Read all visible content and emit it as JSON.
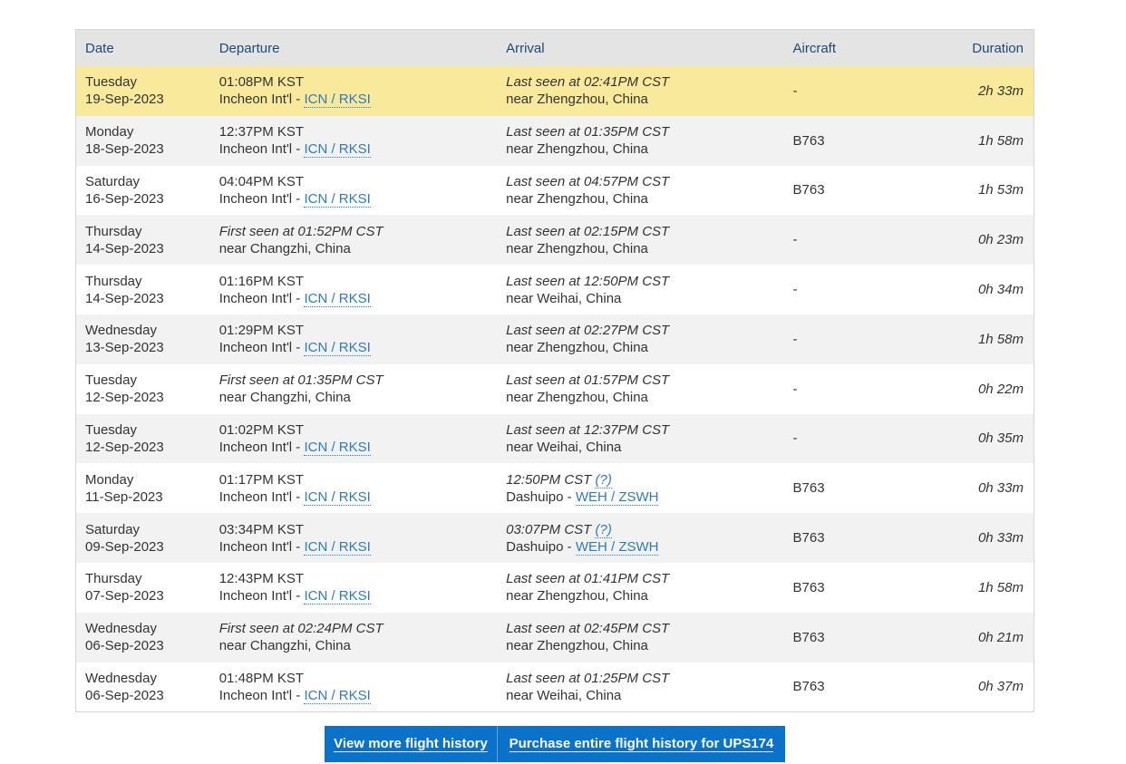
{
  "table": {
    "headers": {
      "date": "Date",
      "departure": "Departure",
      "arrival": "Arrival",
      "aircraft": "Aircraft",
      "duration": "Duration"
    },
    "rows": [
      {
        "day": "Tuesday",
        "date": "19-Sep-2023",
        "dep_time": "01:08PM KST",
        "dep_time_italic": false,
        "dep_place": "Incheon Int'l - ",
        "dep_code": "ICN / RKSI",
        "arr_time": "Last seen at 02:41PM CST",
        "arr_help": "",
        "arr_place": "near Zhengzhou, China",
        "arr_code": "",
        "aircraft": "-",
        "duration": "2h 33m",
        "highlight": true
      },
      {
        "day": "Monday",
        "date": "18-Sep-2023",
        "dep_time": "12:37PM KST",
        "dep_time_italic": false,
        "dep_place": "Incheon Int'l - ",
        "dep_code": "ICN / RKSI",
        "arr_time": "Last seen at 01:35PM CST",
        "arr_help": "",
        "arr_place": "near Zhengzhou, China",
        "arr_code": "",
        "aircraft": "B763",
        "duration": "1h 58m"
      },
      {
        "day": "Saturday",
        "date": "16-Sep-2023",
        "dep_time": "04:04PM KST",
        "dep_time_italic": false,
        "dep_place": "Incheon Int'l - ",
        "dep_code": "ICN / RKSI",
        "arr_time": "Last seen at 04:57PM CST",
        "arr_help": "",
        "arr_place": "near Zhengzhou, China",
        "arr_code": "",
        "aircraft": "B763",
        "duration": "1h 53m"
      },
      {
        "day": "Thursday",
        "date": "14-Sep-2023",
        "dep_time": "First seen at 01:52PM CST",
        "dep_time_italic": true,
        "dep_place": "near Changzhi, China",
        "dep_code": "",
        "arr_time": "Last seen at 02:15PM CST",
        "arr_help": "",
        "arr_place": "near Zhengzhou, China",
        "arr_code": "",
        "aircraft": "-",
        "duration": "0h 23m"
      },
      {
        "day": "Thursday",
        "date": "14-Sep-2023",
        "dep_time": "01:16PM KST",
        "dep_time_italic": false,
        "dep_place": "Incheon Int'l - ",
        "dep_code": "ICN / RKSI",
        "arr_time": "Last seen at 12:50PM CST",
        "arr_help": "",
        "arr_place": "near Weihai, China",
        "arr_code": "",
        "aircraft": "-",
        "duration": "0h 34m"
      },
      {
        "day": "Wednesday",
        "date": "13-Sep-2023",
        "dep_time": "01:29PM KST",
        "dep_time_italic": false,
        "dep_place": "Incheon Int'l - ",
        "dep_code": "ICN / RKSI",
        "arr_time": "Last seen at 02:27PM CST",
        "arr_help": "",
        "arr_place": "near Zhengzhou, China",
        "arr_code": "",
        "aircraft": "-",
        "duration": "1h 58m"
      },
      {
        "day": "Tuesday",
        "date": "12-Sep-2023",
        "dep_time": "First seen at 01:35PM CST",
        "dep_time_italic": true,
        "dep_place": "near Changzhi, China",
        "dep_code": "",
        "arr_time": "Last seen at 01:57PM CST",
        "arr_help": "",
        "arr_place": "near Zhengzhou, China",
        "arr_code": "",
        "aircraft": "-",
        "duration": "0h 22m"
      },
      {
        "day": "Tuesday",
        "date": "12-Sep-2023",
        "dep_time": "01:02PM KST",
        "dep_time_italic": false,
        "dep_place": "Incheon Int'l - ",
        "dep_code": "ICN / RKSI",
        "arr_time": "Last seen at 12:37PM CST",
        "arr_help": "",
        "arr_place": "near Weihai, China",
        "arr_code": "",
        "aircraft": "-",
        "duration": "0h 35m"
      },
      {
        "day": "Monday",
        "date": "11-Sep-2023",
        "dep_time": "01:17PM KST",
        "dep_time_italic": false,
        "dep_place": "Incheon Int'l - ",
        "dep_code": "ICN / RKSI",
        "arr_time": "12:50PM CST ",
        "arr_help": "(?)",
        "arr_place": "Dashuipo - ",
        "arr_code": "WEH / ZSWH",
        "aircraft": "B763",
        "duration": "0h 33m"
      },
      {
        "day": "Saturday",
        "date": "09-Sep-2023",
        "dep_time": "03:34PM KST",
        "dep_time_italic": false,
        "dep_place": "Incheon Int'l - ",
        "dep_code": "ICN / RKSI",
        "arr_time": "03:07PM CST ",
        "arr_help": "(?)",
        "arr_place": "Dashuipo - ",
        "arr_code": "WEH / ZSWH",
        "aircraft": "B763",
        "duration": "0h 33m"
      },
      {
        "day": "Thursday",
        "date": "07-Sep-2023",
        "dep_time": "12:43PM KST",
        "dep_time_italic": false,
        "dep_place": "Incheon Int'l - ",
        "dep_code": "ICN / RKSI",
        "arr_time": "Last seen at 01:41PM CST",
        "arr_help": "",
        "arr_place": "near Zhengzhou, China",
        "arr_code": "",
        "aircraft": "B763",
        "duration": "1h 58m"
      },
      {
        "day": "Wednesday",
        "date": "06-Sep-2023",
        "dep_time": "First seen at 02:24PM CST",
        "dep_time_italic": true,
        "dep_place": "near Changzhi, China",
        "dep_code": "",
        "arr_time": "Last seen at 02:45PM CST",
        "arr_help": "",
        "arr_place": "near Zhengzhou, China",
        "arr_code": "",
        "aircraft": "B763",
        "duration": "0h 21m"
      },
      {
        "day": "Wednesday",
        "date": "06-Sep-2023",
        "dep_time": "01:48PM KST",
        "dep_time_italic": false,
        "dep_place": "Incheon Int'l - ",
        "dep_code": "ICN / RKSI",
        "arr_time": "Last seen at 01:25PM CST",
        "arr_help": "",
        "arr_place": "near Weihai, China",
        "arr_code": "",
        "aircraft": "B763",
        "duration": "0h 37m"
      }
    ]
  },
  "buttons": {
    "view_more": "View more flight history",
    "purchase": "Purchase entire flight history for UPS174"
  },
  "colors": {
    "highlight_row": "#f9e99a",
    "header_bg": "#e4e4e4",
    "header_text": "#1c4a75",
    "link": "#2a7bc6",
    "button_bg": "#0a72c9"
  }
}
